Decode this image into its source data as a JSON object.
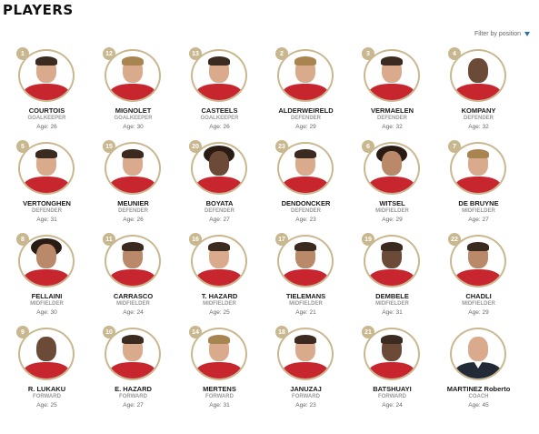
{
  "page": {
    "title": "PLAYERS",
    "filter_label": "Filter by position"
  },
  "players": [
    {
      "number": "1",
      "name": "COURTOIS",
      "position": "GOALKEEPER",
      "age": "Age: 26",
      "tone": "light",
      "hair": "dark"
    },
    {
      "number": "12",
      "name": "MIGNOLET",
      "position": "GOALKEEPER",
      "age": "Age: 30",
      "tone": "light",
      "hair": "light"
    },
    {
      "number": "13",
      "name": "CASTEELS",
      "position": "GOALKEEPER",
      "age": "Age: 26",
      "tone": "light",
      "hair": "dark"
    },
    {
      "number": "2",
      "name": "ALDERWEIRELD",
      "position": "DEFENDER",
      "age": "Age: 29",
      "tone": "light",
      "hair": "light"
    },
    {
      "number": "3",
      "name": "VERMAELEN",
      "position": "DEFENDER",
      "age": "Age: 32",
      "tone": "light",
      "hair": "dark"
    },
    {
      "number": "4",
      "name": "KOMPANY",
      "position": "DEFENDER",
      "age": "Age: 32",
      "tone": "dark",
      "hair": "none"
    },
    {
      "number": "5",
      "name": "VERTONGHEN",
      "position": "DEFENDER",
      "age": "Age: 31",
      "tone": "light",
      "hair": "dark"
    },
    {
      "number": "15",
      "name": "MEUNIER",
      "position": "DEFENDER",
      "age": "Age: 26",
      "tone": "light",
      "hair": "dark"
    },
    {
      "number": "20",
      "name": "BOYATA",
      "position": "DEFENDER",
      "age": "Age: 27",
      "tone": "dark",
      "hair": "curly"
    },
    {
      "number": "23",
      "name": "DENDONCKER",
      "position": "DEFENDER",
      "age": "Age: 23",
      "tone": "light",
      "hair": "dark"
    },
    {
      "number": "6",
      "name": "WITSEL",
      "position": "MIDFIELDER",
      "age": "Age: 29",
      "tone": "mid",
      "hair": "curly"
    },
    {
      "number": "7",
      "name": "DE BRUYNE",
      "position": "MIDFIELDER",
      "age": "Age: 27",
      "tone": "light",
      "hair": "light"
    },
    {
      "number": "8",
      "name": "FELLAINI",
      "position": "MIDFIELDER",
      "age": "Age: 30",
      "tone": "mid",
      "hair": "curly"
    },
    {
      "number": "11",
      "name": "CARRASCO",
      "position": "MIDFIELDER",
      "age": "Age: 24",
      "tone": "mid",
      "hair": "dark"
    },
    {
      "number": "16",
      "name": "T. HAZARD",
      "position": "MIDFIELDER",
      "age": "Age: 25",
      "tone": "light",
      "hair": "dark"
    },
    {
      "number": "17",
      "name": "TIELEMANS",
      "position": "MIDFIELDER",
      "age": "Age: 21",
      "tone": "mid",
      "hair": "dark"
    },
    {
      "number": "19",
      "name": "DEMBELE",
      "position": "MIDFIELDER",
      "age": "Age: 31",
      "tone": "dark",
      "hair": "dark"
    },
    {
      "number": "22",
      "name": "CHADLI",
      "position": "MIDFIELDER",
      "age": "Age: 29",
      "tone": "mid",
      "hair": "dark"
    },
    {
      "number": "9",
      "name": "R. LUKAKU",
      "position": "FORWARD",
      "age": "Age: 25",
      "tone": "dark",
      "hair": "none"
    },
    {
      "number": "10",
      "name": "E. HAZARD",
      "position": "FORWARD",
      "age": "Age: 27",
      "tone": "light",
      "hair": "dark"
    },
    {
      "number": "14",
      "name": "MERTENS",
      "position": "FORWARD",
      "age": "Age: 31",
      "tone": "light",
      "hair": "light"
    },
    {
      "number": "18",
      "name": "JANUZAJ",
      "position": "FORWARD",
      "age": "Age: 23",
      "tone": "light",
      "hair": "dark"
    },
    {
      "number": "21",
      "name": "BATSHUAYI",
      "position": "FORWARD",
      "age": "Age: 24",
      "tone": "dark",
      "hair": "dark"
    },
    {
      "number": "",
      "name": "MARTINEZ Roberto",
      "position": "COACH",
      "age": "Age: 45",
      "tone": "light",
      "hair": "none",
      "coach": true
    }
  ],
  "colors": {
    "accent_gold": "#c9b88f",
    "kit_red": "#c7262f",
    "filter_blue": "#2b6fb6"
  }
}
